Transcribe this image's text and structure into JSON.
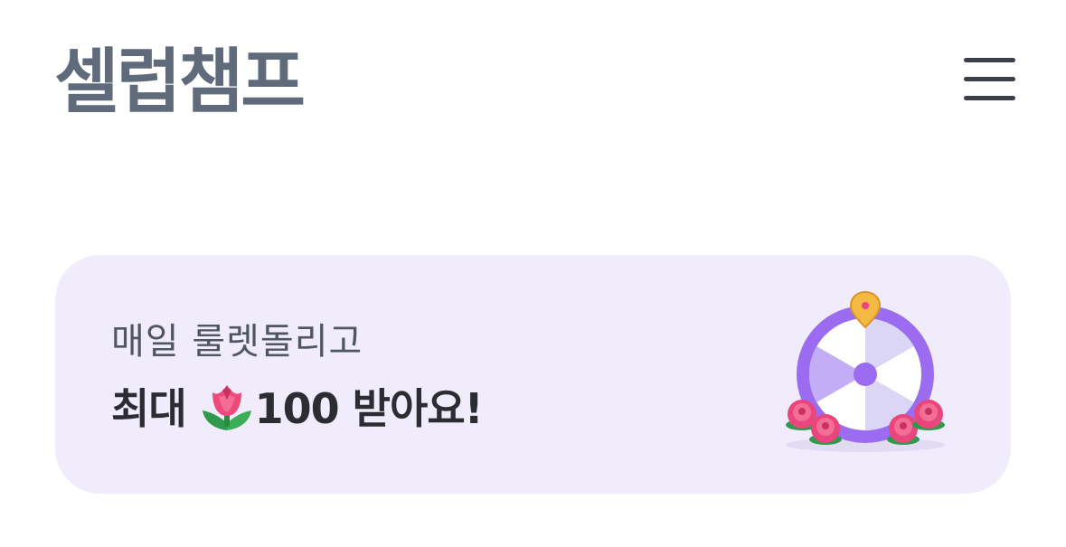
{
  "header": {
    "logo_text": "셀럽챔프",
    "menu_icon": "hamburger-menu-icon"
  },
  "banner": {
    "subtitle": "매일 룰렛돌리고",
    "title_prefix": "최대",
    "title_icon": "tulip-icon",
    "title_suffix": "100 받아요!",
    "illustration": "roulette-wheel-icon",
    "colors": {
      "background": "#f0ecfc",
      "wheel_ring": "#9b6cf0",
      "pin": "#f4b942",
      "rose": "#e8467c"
    }
  }
}
